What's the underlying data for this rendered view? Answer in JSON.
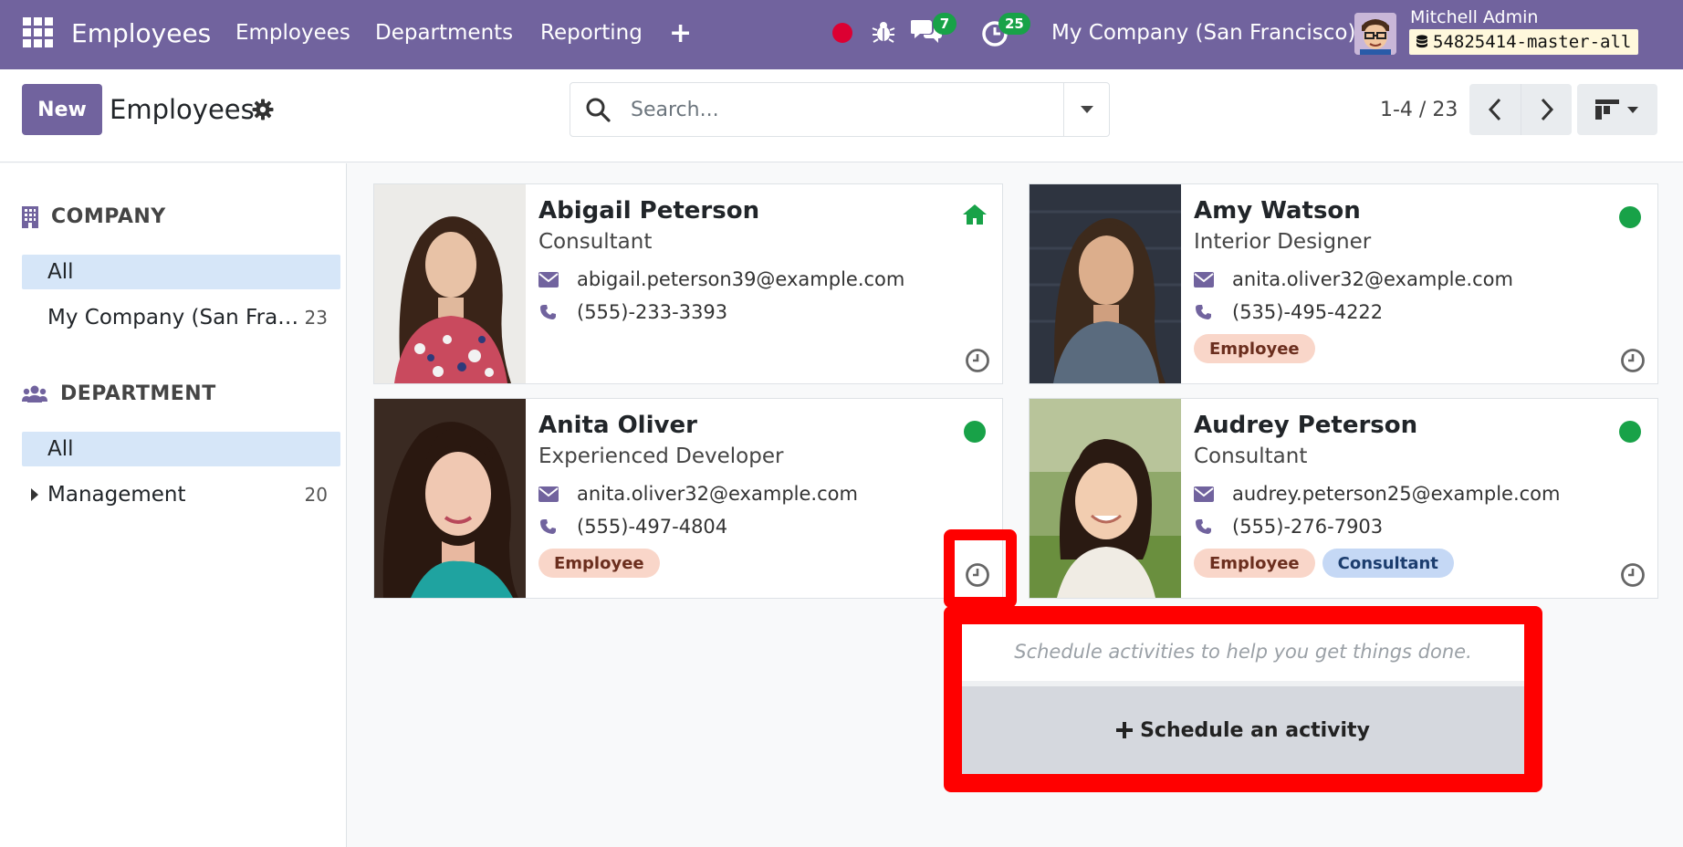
{
  "navbar": {
    "brand": "Employees",
    "menu": [
      "Employees",
      "Departments",
      "Reporting"
    ],
    "chat_count": "7",
    "activity_count": "25",
    "company": "My Company (San Francisco)",
    "user": "Mitchell Admin",
    "db": "54825414-master-all"
  },
  "control": {
    "new_label": "New",
    "title": "Employees",
    "search_placeholder": "Search...",
    "pager": "1-4 / 23"
  },
  "sidebar": {
    "company_head": "COMPANY",
    "company_items": [
      {
        "label": "All"
      },
      {
        "label": "My Company (San Fra…",
        "count": "23"
      }
    ],
    "department_head": "DEPARTMENT",
    "department_items": [
      {
        "label": "All"
      },
      {
        "label": "Management",
        "count": "20"
      }
    ]
  },
  "cards": [
    {
      "name": "Abigail Peterson",
      "job": "Consultant",
      "email": "abigail.peterson39@example.com",
      "phone": "(555)-233-3393",
      "tags": []
    },
    {
      "name": "Amy Watson",
      "job": "Interior Designer",
      "email": "anita.oliver32@example.com",
      "phone": "(535)-495-4222",
      "tags": [
        "Employee"
      ]
    },
    {
      "name": "Anita Oliver",
      "job": "Experienced Developer",
      "email": "anita.oliver32@example.com",
      "phone": "(555)-497-4804",
      "tags": [
        "Employee"
      ]
    },
    {
      "name": "Audrey Peterson",
      "job": "Consultant",
      "email": "audrey.peterson25@example.com",
      "phone": "(555)-276-7903",
      "tags": [
        "Employee",
        "Consultant"
      ]
    }
  ],
  "popover": {
    "hint": "Schedule activities to help you get things done.",
    "button": "Schedule an activity"
  },
  "colors": {
    "brand": "#71639e",
    "presence_online": "#18a248",
    "highlight": "#ff0000"
  }
}
